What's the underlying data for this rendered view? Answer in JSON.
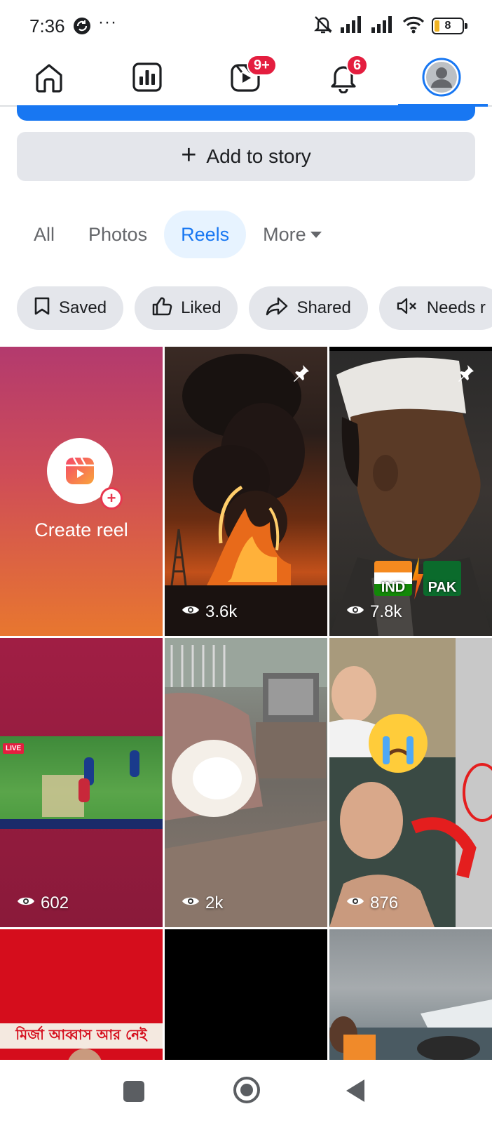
{
  "status_bar": {
    "time": "7:36",
    "more": "···",
    "battery": "8"
  },
  "top_nav": {
    "items": [
      {
        "icon": "home-icon"
      },
      {
        "icon": "dashboard-icon"
      },
      {
        "icon": "reels-icon",
        "badge": "9+"
      },
      {
        "icon": "bell-icon",
        "badge": "6"
      },
      {
        "icon": "profile-avatar-icon"
      }
    ],
    "active": "profile"
  },
  "add_story": {
    "label": "Add to story"
  },
  "tabs": [
    {
      "label": "All"
    },
    {
      "label": "Photos"
    },
    {
      "label": "Reels"
    },
    {
      "label": "More"
    }
  ],
  "active_tab": "Reels",
  "chips": [
    {
      "label": "Saved",
      "icon": "bookmark-icon"
    },
    {
      "label": "Liked",
      "icon": "thumbs-up-icon"
    },
    {
      "label": "Shared",
      "icon": "share-icon"
    },
    {
      "label": "Needs r",
      "icon": "muted-speaker-icon"
    }
  ],
  "create_reel": {
    "label": "Create reel"
  },
  "reels": [
    {
      "views": "3.6k",
      "pinned": true,
      "scene": "fire-explosion"
    },
    {
      "views": "7.8k",
      "pinned": true,
      "scene": "man-profile",
      "overlay": [
        "IND",
        "PAK"
      ]
    },
    {
      "views": "602",
      "scene": "cricket-match",
      "live": "LIVE"
    },
    {
      "views": "2k",
      "scene": "room-sparks"
    },
    {
      "views": "876",
      "scene": "hospital-collage"
    }
  ],
  "partial_reels": [
    {
      "scene": "red-news",
      "caption": "মির্জা আব্বাস আর নেই"
    },
    {
      "scene": "black"
    },
    {
      "scene": "plane-water"
    }
  ],
  "colors": {
    "accent": "#1877f2",
    "badge": "#e41e3f",
    "chip_bg": "#e4e6eb"
  }
}
